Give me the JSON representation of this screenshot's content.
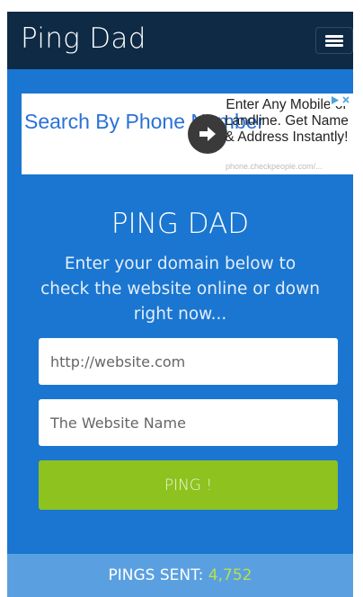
{
  "header": {
    "brand": "Ping Dad"
  },
  "ad": {
    "left_text": "Search By Phone Number",
    "right_text": "Enter Any Mobile or Landline. Get Name & Address Instantly!",
    "url": "phone.checkpeople.com/..."
  },
  "hero": {
    "title": "PING DAD",
    "subtitle": "Enter your domain below to check the website online or down right now..."
  },
  "form": {
    "url_placeholder": "http://website.com",
    "name_placeholder": "The Website Name",
    "submit_label": "PING !"
  },
  "footer": {
    "label": "PINGS SENT: ",
    "count": "4,752"
  },
  "colors": {
    "navbar": "#0e2a44",
    "page_blue": "#1a76d0",
    "button_green": "#8dc21f",
    "footer_blue": "#5aa0e0",
    "count_green": "#b8e04a"
  }
}
